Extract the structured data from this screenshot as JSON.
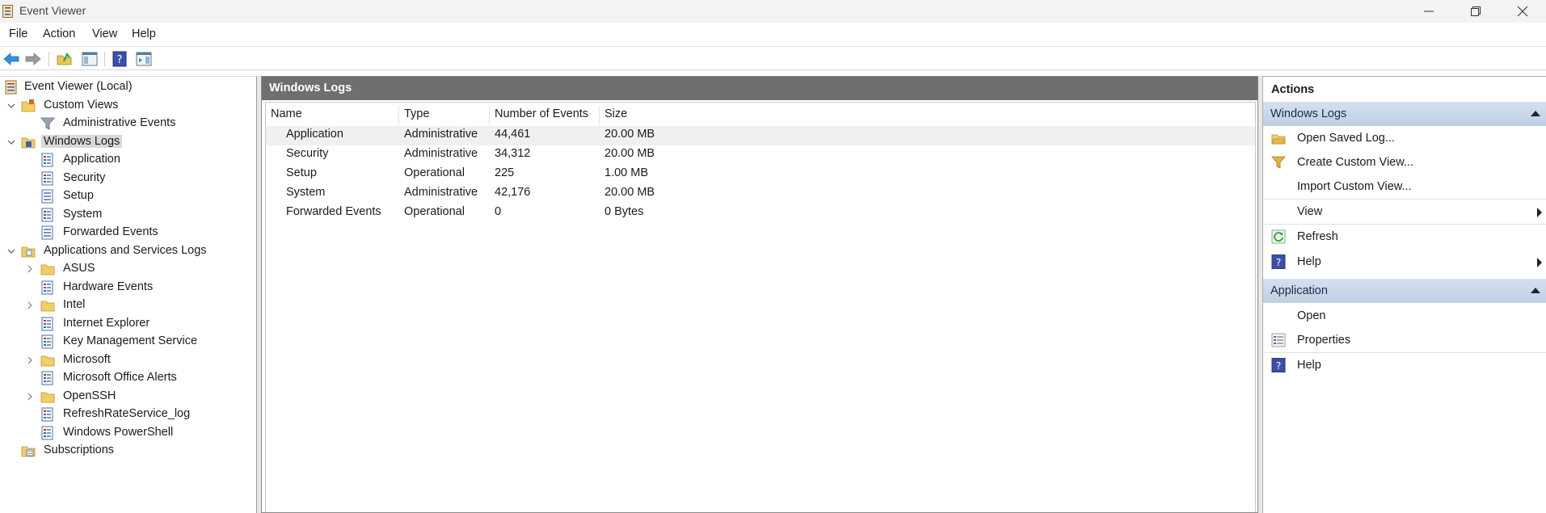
{
  "window": {
    "title": "Event Viewer"
  },
  "menu": [
    "File",
    "Action",
    "View",
    "Help"
  ],
  "toolbar": {
    "buttons": [
      "back-icon",
      "forward-icon",
      "open-folder-icon",
      "show-hide-tree-icon",
      "help-icon",
      "show-hide-action-pane-icon"
    ]
  },
  "tree": {
    "root": "Event Viewer (Local)",
    "custom_views": "Custom Views",
    "administrative_events": "Administrative Events",
    "windows_logs": "Windows Logs",
    "application": "Application",
    "security": "Security",
    "setup": "Setup",
    "system": "System",
    "forwarded_events": "Forwarded Events",
    "apps_services_logs": "Applications and Services Logs",
    "asus": "ASUS",
    "hardware_events": "Hardware Events",
    "intel": "Intel",
    "internet_explorer": "Internet Explorer",
    "key_management_service": "Key Management Service",
    "microsoft": "Microsoft",
    "microsoft_office_alerts": "Microsoft Office Alerts",
    "openssh": "OpenSSH",
    "refreshrate_log": "RefreshRateService_log",
    "windows_powershell": "Windows PowerShell",
    "subscriptions": "Subscriptions"
  },
  "center": {
    "title": "Windows Logs",
    "columns": [
      "Name",
      "Type",
      "Number of Events",
      "Size"
    ],
    "rows": [
      [
        "Application",
        "Administrative",
        "44,461",
        "20.00 MB"
      ],
      [
        "Security",
        "Administrative",
        "34,312",
        "20.00 MB"
      ],
      [
        "Setup",
        "Operational",
        "225",
        "1.00 MB"
      ],
      [
        "System",
        "Administrative",
        "42,176",
        "20.00 MB"
      ],
      [
        "Forwarded Events",
        "Operational",
        "0",
        "0 Bytes"
      ]
    ]
  },
  "actions": {
    "title": "Actions",
    "section1": {
      "header": "Windows Logs",
      "items": [
        "Open Saved Log...",
        "Create Custom View...",
        "Import Custom View...",
        "View",
        "Refresh",
        "Help"
      ]
    },
    "section2": {
      "header": "Application",
      "items": [
        "Open",
        "Properties",
        "Help"
      ]
    }
  },
  "colors": {
    "center_header": "#6f6f6f",
    "action_header": "#c8d7e8",
    "selection": "#d9d9d9"
  }
}
